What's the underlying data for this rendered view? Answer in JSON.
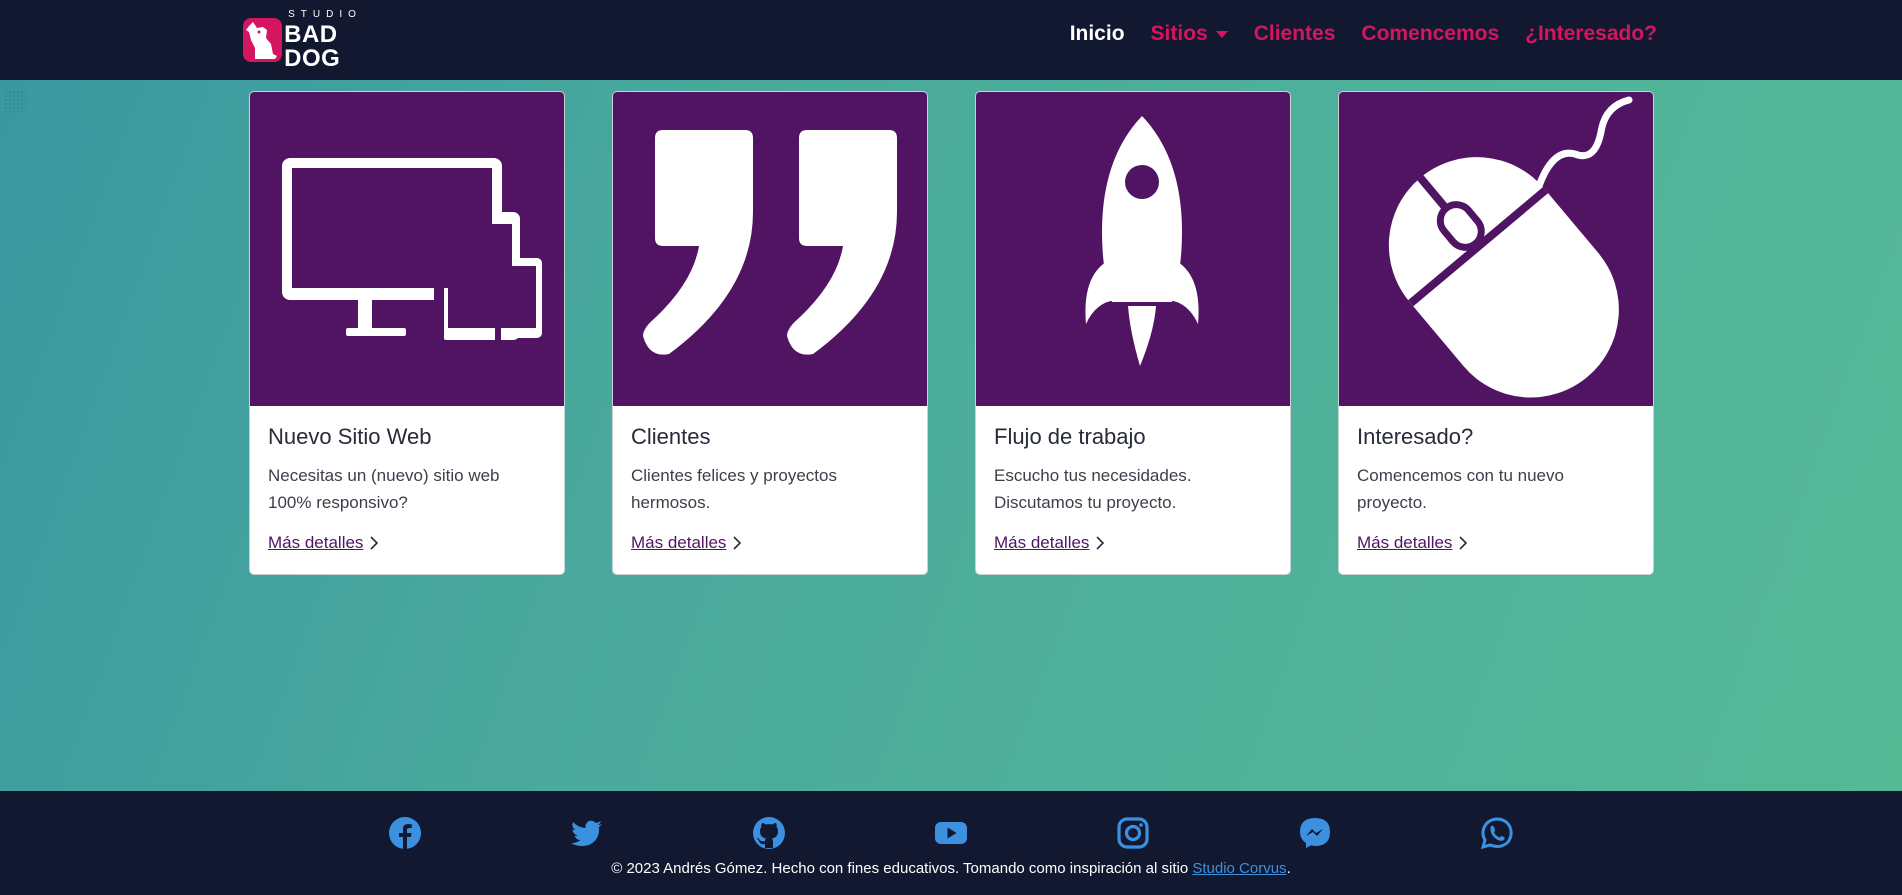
{
  "brand": {
    "small": "STUDIO",
    "big": "BAD DOG",
    "logo_icon": "dog-icon"
  },
  "nav": {
    "items": [
      {
        "label": "Inicio",
        "active": true
      },
      {
        "label": "Sitios",
        "dropdown": true
      },
      {
        "label": "Clientes"
      },
      {
        "label": "Comencemos"
      },
      {
        "label": "¿Interesado?"
      }
    ]
  },
  "cards": [
    {
      "title": "Nuevo Sitio Web",
      "text": "Necesitas un (nuevo) sitio web 100% responsivo?",
      "link": "Más detalles",
      "icon": "devices-icon"
    },
    {
      "title": "Clientes",
      "text": "Clientes felices y proyectos hermosos.",
      "link": "Más detalles",
      "icon": "quote-icon"
    },
    {
      "title": "Flujo de trabajo",
      "text": "Escucho tus necesidades. Discutamos tu proyecto.",
      "link": "Más detalles",
      "icon": "rocket-icon"
    },
    {
      "title": "Interesado?",
      "text": "Comencemos con tu nuevo proyecto.",
      "link": "Más detalles",
      "icon": "mouse-icon"
    }
  ],
  "footer": {
    "socials": [
      "facebook-icon",
      "twitter-icon",
      "github-icon",
      "youtube-icon",
      "instagram-icon",
      "messenger-icon",
      "whatsapp-icon"
    ],
    "copyright": "© 2023 Andrés Gómez. Hecho con fines educativos. Tomando como inspiración al sitio ",
    "link_text": "Studio Corvus",
    "end": "."
  },
  "colors": {
    "navbar": "#131831",
    "accent": "#d5155f",
    "card_image": "#501463",
    "social": "#3b91e0",
    "gradient_start": "#3a98a0",
    "gradient_end": "#55b996"
  }
}
